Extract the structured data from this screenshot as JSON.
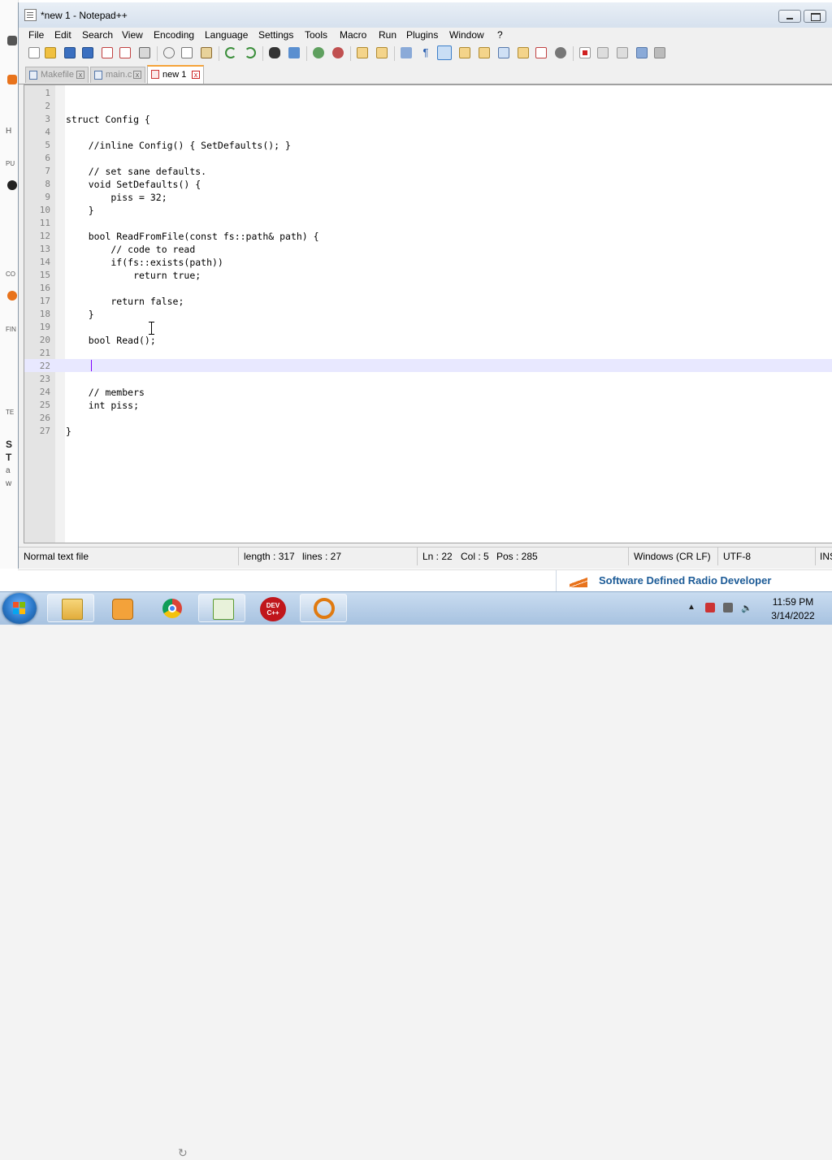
{
  "window": {
    "title": "*new 1 - Notepad++"
  },
  "menu": [
    "File",
    "Edit",
    "Search",
    "View",
    "Encoding",
    "Language",
    "Settings",
    "Tools",
    "Macro",
    "Run",
    "Plugins",
    "Window",
    "?"
  ],
  "tabs": [
    {
      "label": "Makefile",
      "active": false
    },
    {
      "label": "main.c",
      "active": false
    },
    {
      "label": "new 1",
      "active": true
    }
  ],
  "editor": {
    "current_line": 22,
    "lines": [
      "",
      "",
      "struct Config {",
      "",
      "    //inline Config() { SetDefaults(); }",
      "",
      "    // set sane defaults.",
      "    void SetDefaults() {",
      "        piss = 32;",
      "    }",
      "",
      "    bool ReadFromFile(const fs::path& path) {",
      "        // code to read",
      "        if(fs::exists(path))",
      "            return true;",
      "",
      "        return false;",
      "    }",
      "",
      "    bool Read();",
      "",
      "",
      "",
      "    // members",
      "    int piss;",
      "",
      "}"
    ]
  },
  "status": {
    "file_type": "Normal text file",
    "length": "length : 317",
    "lines": "lines : 27",
    "ln": "Ln : 22",
    "col": "Col : 5",
    "pos": "Pos : 285",
    "eol": "Windows (CR LF)",
    "encoding": "UTF-8",
    "insert": "INS"
  },
  "background": {
    "ad_text": "Software Defined Radio Developer",
    "left_fragments": [
      "H",
      "PU",
      "CO",
      "FIN",
      "TE",
      "S",
      "T",
      "a",
      "w"
    ]
  },
  "taskbar": {
    "apps": [
      "file-explorer",
      "media-player",
      "chrome",
      "notepad-plus-plus",
      "dev-cpp",
      "search-magnifier"
    ],
    "dev_label_1": "DEV",
    "dev_label_2": "C++",
    "time": "11:59 PM",
    "date": "3/14/2022"
  },
  "colors": {
    "active_tab_accent": "#f5a33a",
    "current_line_bg": "#e8e8ff",
    "caret": "#8000ff",
    "ad_text": "#1b5a96"
  }
}
